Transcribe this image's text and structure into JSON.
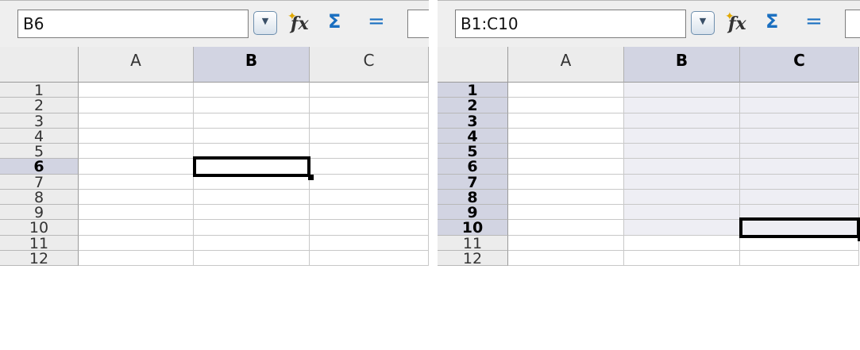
{
  "panels": [
    {
      "name_box": "B6",
      "columns": [
        "A",
        "B",
        "C"
      ],
      "rows": [
        "1",
        "2",
        "3",
        "4",
        "5",
        "6",
        "7",
        "8",
        "9",
        "10",
        "11",
        "12"
      ],
      "selected_columns": [
        "B"
      ],
      "selected_rows": [
        "6"
      ],
      "active_cell": "B6",
      "selection": "B6"
    },
    {
      "name_box": "B1:C10",
      "columns": [
        "A",
        "B",
        "C"
      ],
      "rows": [
        "1",
        "2",
        "3",
        "4",
        "5",
        "6",
        "7",
        "8",
        "9",
        "10",
        "11",
        "12"
      ],
      "selected_columns": [
        "B",
        "C"
      ],
      "selected_rows": [
        "1",
        "2",
        "3",
        "4",
        "5",
        "6",
        "7",
        "8",
        "9",
        "10"
      ],
      "active_cell": "C10",
      "selection": "B1:C10"
    }
  ],
  "toolbar": {
    "dropdown_icon": "chevron-down-icon",
    "function_wizard_icon": "function-wizard-icon",
    "function_wizard_label": "fx",
    "sum_icon": "sum-icon",
    "sum_label": "Σ",
    "function_icon": "equals-icon",
    "function_label": "="
  },
  "colors": {
    "selection_header": "#d2d4e2",
    "selection_fill": "#eeeef4",
    "header_bg": "#ececec",
    "toolbar_bg": "#efefef",
    "accent": "#1a6fc0"
  }
}
